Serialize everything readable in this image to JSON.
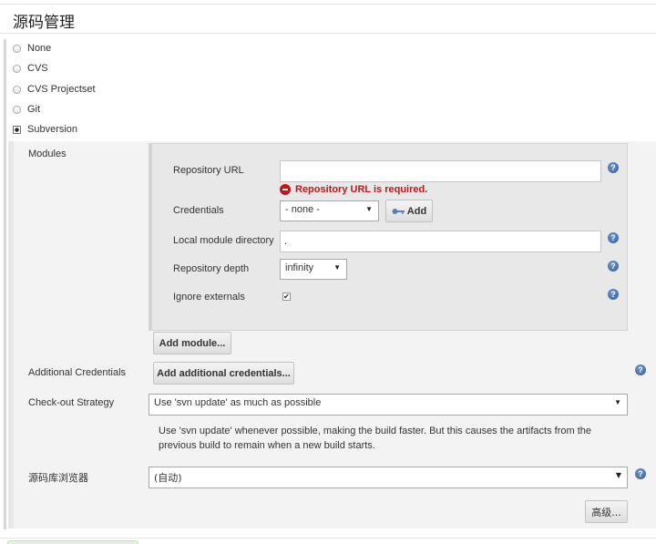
{
  "section_title": "源码管理",
  "scm_options": [
    {
      "label": "None",
      "checked": false
    },
    {
      "label": "CVS",
      "checked": false
    },
    {
      "label": "CVS Projectset",
      "checked": false
    },
    {
      "label": "Git",
      "checked": false
    },
    {
      "label": "Subversion",
      "checked": true
    }
  ],
  "modules": {
    "label": "Modules",
    "repository_url_label": "Repository URL",
    "repository_url_value": "",
    "error_text": "Repository URL is required.",
    "credentials_label": "Credentials",
    "credentials_selected": "- none -",
    "add_button": "Add",
    "local_module_label": "Local module directory",
    "local_module_value": ".",
    "depth_label": "Repository depth",
    "depth_selected": "infinity",
    "ignore_externals_label": "Ignore externals",
    "ignore_externals_checked": true,
    "add_module_button": "Add module..."
  },
  "additional_credentials": {
    "label": "Additional Credentials",
    "button": "Add additional credentials..."
  },
  "checkout_strategy": {
    "label": "Check-out Strategy",
    "selected": "Use 'svn update' as much as possible",
    "description": "Use 'svn update' whenever possible, making the build faster. But this causes the artifacts from the previous build to remain when a new build starts."
  },
  "repo_browser": {
    "label": "源码库浏览器",
    "selected": "(自动)"
  },
  "advanced_button": "高级...",
  "colors": {
    "error": "#c4161c",
    "help_icon": "#2f5fa5"
  }
}
